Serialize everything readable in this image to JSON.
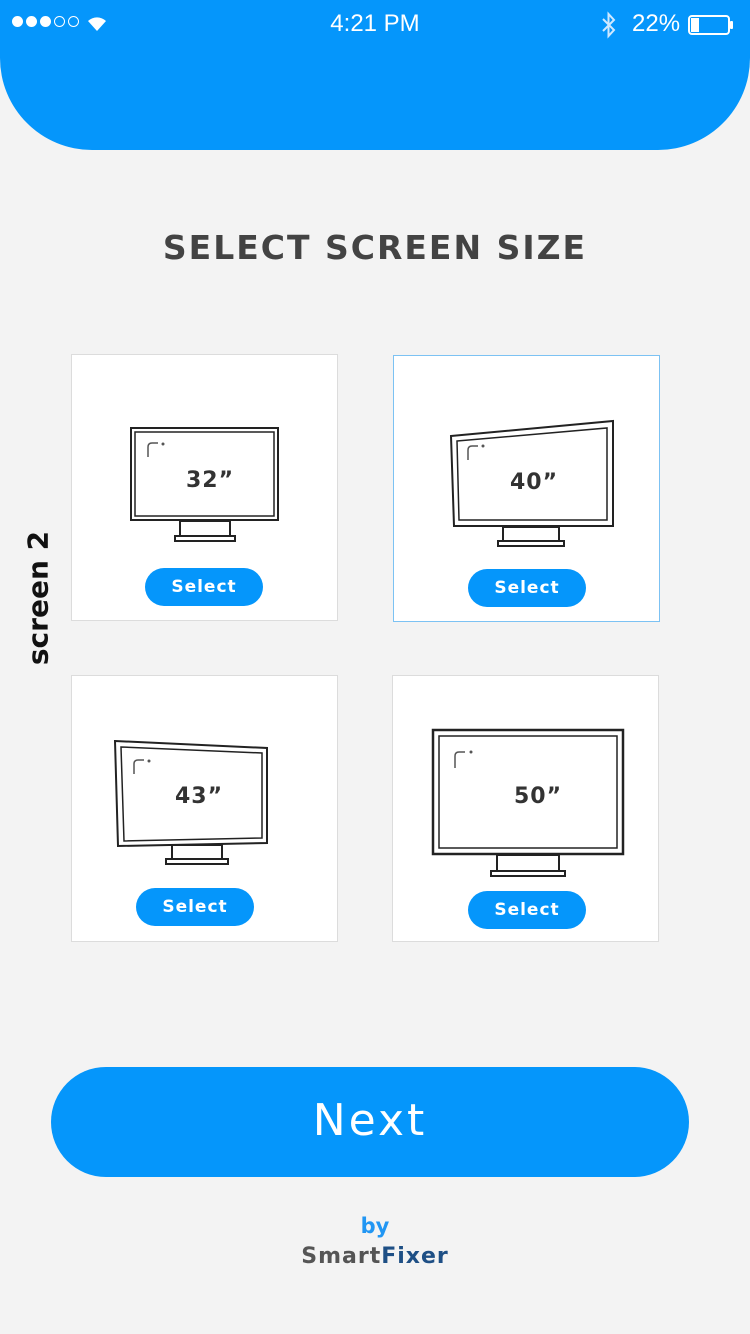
{
  "status_bar": {
    "time": "4:21 PM",
    "battery_percent": "22%",
    "battery_level": 0.22,
    "signal_bars_filled": 3,
    "signal_bars_total": 5
  },
  "header": {
    "color": "#0596fb"
  },
  "page": {
    "title": "SELECT SCREEN SIZE",
    "side_label": "screen 2"
  },
  "options": [
    {
      "size": "32”",
      "button_label": "Select",
      "selected": false
    },
    {
      "size": "40”",
      "button_label": "Select",
      "selected": true
    },
    {
      "size": "43”",
      "button_label": "Select",
      "selected": false
    },
    {
      "size": "50”",
      "button_label": "Select",
      "selected": false
    }
  ],
  "next_button": {
    "label": "Next"
  },
  "footer": {
    "by": "by",
    "brand_part1": "Smart",
    "brand_part2": "Fixer"
  },
  "colors": {
    "accent": "#0596fb",
    "background": "#f3f3f3",
    "selected_border": "#7cc2f3"
  },
  "icons": [
    "signal-icon",
    "wifi-icon",
    "bluetooth-icon",
    "battery-icon",
    "tv-monitor-icon"
  ]
}
